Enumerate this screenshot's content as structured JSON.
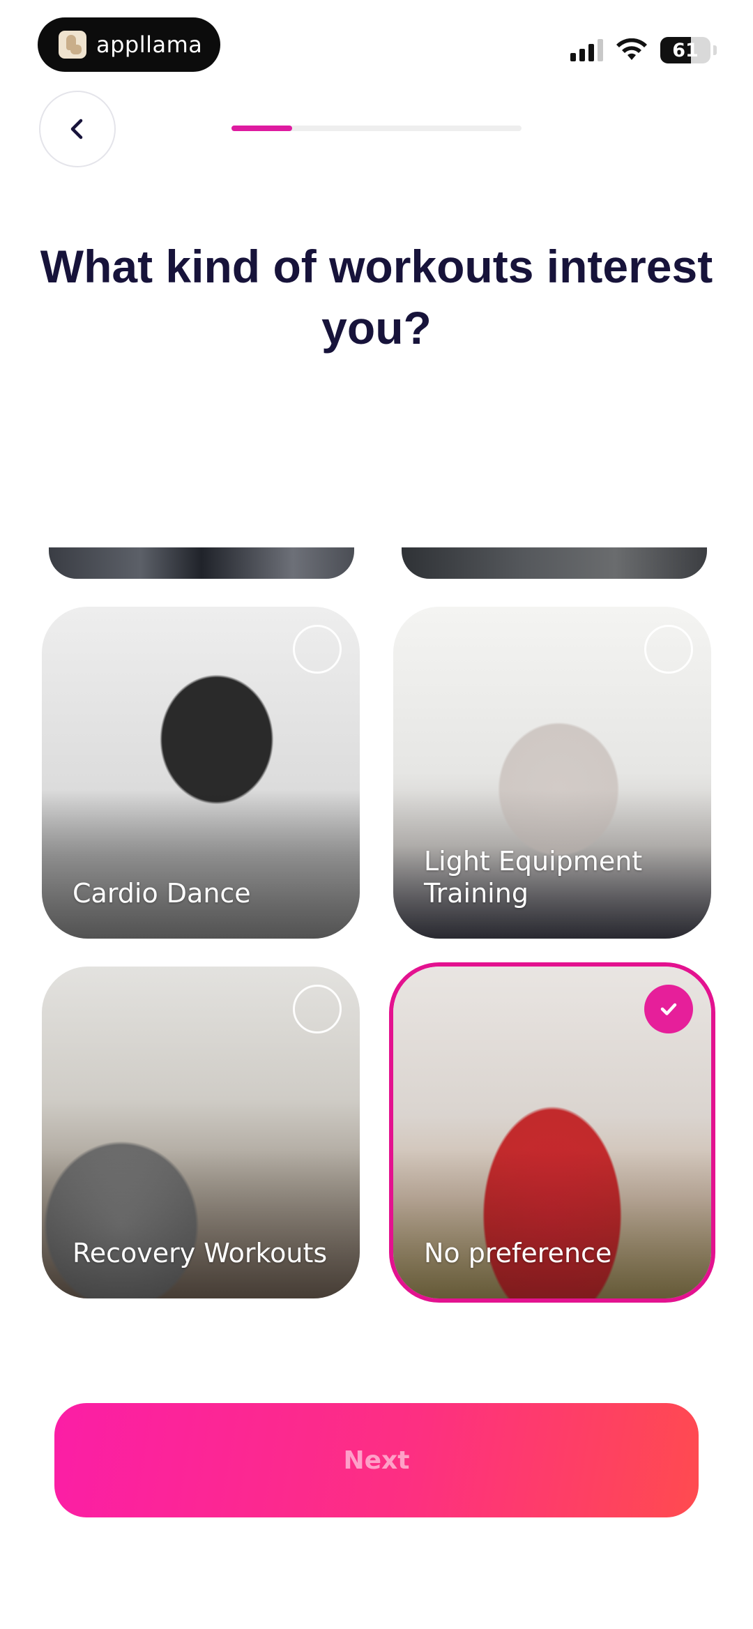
{
  "status_bar": {
    "app_pill_label": "appllama",
    "battery_level": 61,
    "battery_text": "61"
  },
  "header": {
    "back_icon": "chevron-left-icon",
    "progress": 0.21
  },
  "title": "What kind of workouts interest you?",
  "options": [
    {
      "label": "Cardio Dance",
      "selected": false
    },
    {
      "label": "Light Equipment Training",
      "selected": false
    },
    {
      "label": "Recovery Workouts",
      "selected": false
    },
    {
      "label": "No preference",
      "selected": true
    }
  ],
  "next_button": {
    "label": "Next"
  },
  "colors": {
    "accent": "#e3128f",
    "title": "#17133a",
    "button_gradient_start": "#fb1ea6",
    "button_gradient_end": "#ff4b4f"
  }
}
